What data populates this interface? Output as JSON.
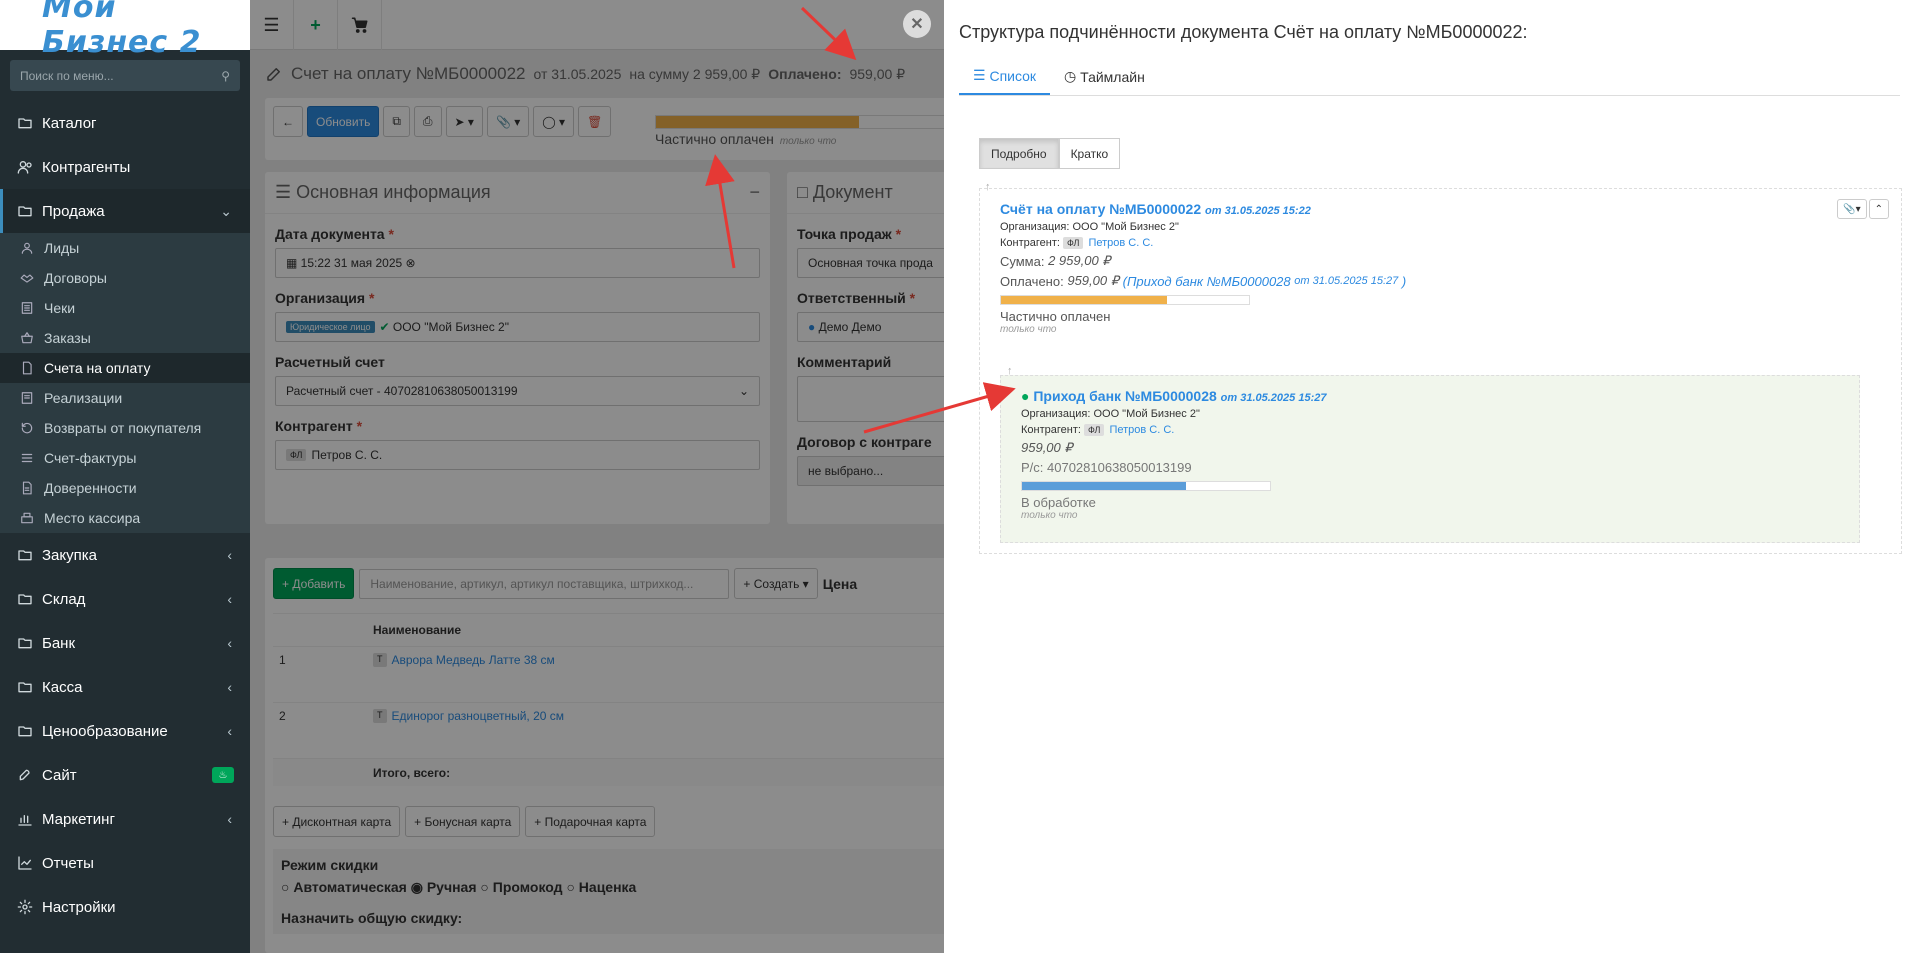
{
  "app": {
    "logo_text": "Мой Бизнес 2"
  },
  "sidebar": {
    "search_placeholder": "Поиск по меню...",
    "items": [
      {
        "label": "Каталог",
        "icon": "folder-icon"
      },
      {
        "label": "Контрагенты",
        "icon": "users-icon"
      },
      {
        "label": "Продажа",
        "icon": "folder-icon"
      },
      {
        "label": "Закупка",
        "icon": "folder-icon"
      },
      {
        "label": "Склад",
        "icon": "folder-icon"
      },
      {
        "label": "Банк",
        "icon": "folder-icon"
      },
      {
        "label": "Касса",
        "icon": "folder-icon"
      },
      {
        "label": "Ценообразование",
        "icon": "folder-icon"
      },
      {
        "label": "Сайт",
        "icon": "rocket-icon"
      },
      {
        "label": "Маркетинг",
        "icon": "chart-icon"
      },
      {
        "label": "Отчеты",
        "icon": "line-chart-icon"
      },
      {
        "label": "Настройки",
        "icon": "gear-icon"
      }
    ],
    "sub_items": [
      "Лиды",
      "Договоры",
      "Чеки",
      "Заказы",
      "Счета на оплату",
      "Реализации",
      "Возвраты от покупателя",
      "Счет-фактуры",
      "Доверенности",
      "Место кассира"
    ]
  },
  "header": {
    "title": "Счет на оплату №МБ0000022",
    "date": "от 31.05.2025",
    "sum": "на сумму 2 959,00 ₽",
    "paid_label": "Оплачено:",
    "paid_value": "959,00 ₽"
  },
  "toolbar": {
    "update_label": "Обновить",
    "status_label": "Частично оплачен",
    "status_time": "только что",
    "status_progress": 0.68
  },
  "main_info": {
    "title": "Основная информация",
    "date_label": "Дата документа",
    "date_value": "15:22 31 мая 2025",
    "org_label": "Организация",
    "org_tag": "Юридическое лицо",
    "org_value": "ООО \"Мой Бизнес 2\"",
    "account_label": "Расчетный счет",
    "account_value": "Расчетный счет - 40702810638050013199",
    "contractor_label": "Контрагент",
    "contractor_tag": "ФЛ",
    "contractor_value": "Петров С. С."
  },
  "doc_box": {
    "title": "Документ",
    "pos_label": "Точка продаж",
    "pos_value": "Основная точка прода",
    "resp_label": "Ответственный",
    "resp_value": "Демо Демо",
    "comment_label": "Комментарий",
    "contract_label": "Договор с контраге",
    "contract_value": "не выбрано..."
  },
  "goods": {
    "add_label": "Добавить",
    "search_placeholder": "Наименование, артикул, артикул поставщика, штрихкод...",
    "create_label": "Создать",
    "price_label": "Цена",
    "col_name": "Наименование",
    "rows": [
      {
        "num": "1",
        "tag": "Т",
        "name": "Аврора Медведь Латте 38 см"
      },
      {
        "num": "2",
        "tag": "Т",
        "name": "Единорог разноцветный, 20 см"
      }
    ],
    "total_label": "Итого, всего:",
    "cards": [
      "Дисконтная карта",
      "Бонусная карта",
      "Подарочная карта"
    ],
    "discount_title": "Режим скидки",
    "discount_modes": [
      "Автоматическая",
      "Ручная",
      "Промокод",
      "Наценка"
    ],
    "common_discount": "Назначить общую скидку:"
  },
  "panel": {
    "title": "Структура подчинённости документа Счёт на оплату №МБ0000022:",
    "tabs": [
      "Список",
      "Таймлайн"
    ],
    "modes": [
      "Подробно",
      "Кратко"
    ],
    "root": {
      "title": "Счёт на оплату №МБ0000022",
      "date": "от 31.05.2025 15:22",
      "org": "Организация: ООО \"Мой Бизнес 2\"",
      "contractor_label": "Контрагент:",
      "contractor_tag": "ФЛ",
      "contractor": "Петров С. С.",
      "sum_label": "Сумма:",
      "sum": "2 959,00 ₽",
      "paid_label": "Оплачено:",
      "paid": "959,00 ₽",
      "paid_link": "(Приход банк №МБ0000028",
      "paid_link_date": "от 31.05.2025 15:27",
      "paid_link_end": ")",
      "progress": 0.67,
      "status": "Частично оплачен",
      "time": "только что"
    },
    "child": {
      "title": "Приход банк №МБ0000028",
      "date": "от 31.05.2025 15:27",
      "org": "Организация: ООО \"Мой Бизнес 2\"",
      "contractor_label": "Контрагент:",
      "contractor_tag": "ФЛ",
      "contractor": "Петров С. С.",
      "sum": "959,00 ₽",
      "account": "Р/с: 40702810638050013199",
      "progress": 0.66,
      "status": "В обработке",
      "time": "только что"
    }
  },
  "colors": {
    "accent": "#2d8ae0",
    "sidebar": "#222d32",
    "orange": "#f0b14a",
    "green": "#00a65a",
    "arrow": "#e53935"
  }
}
